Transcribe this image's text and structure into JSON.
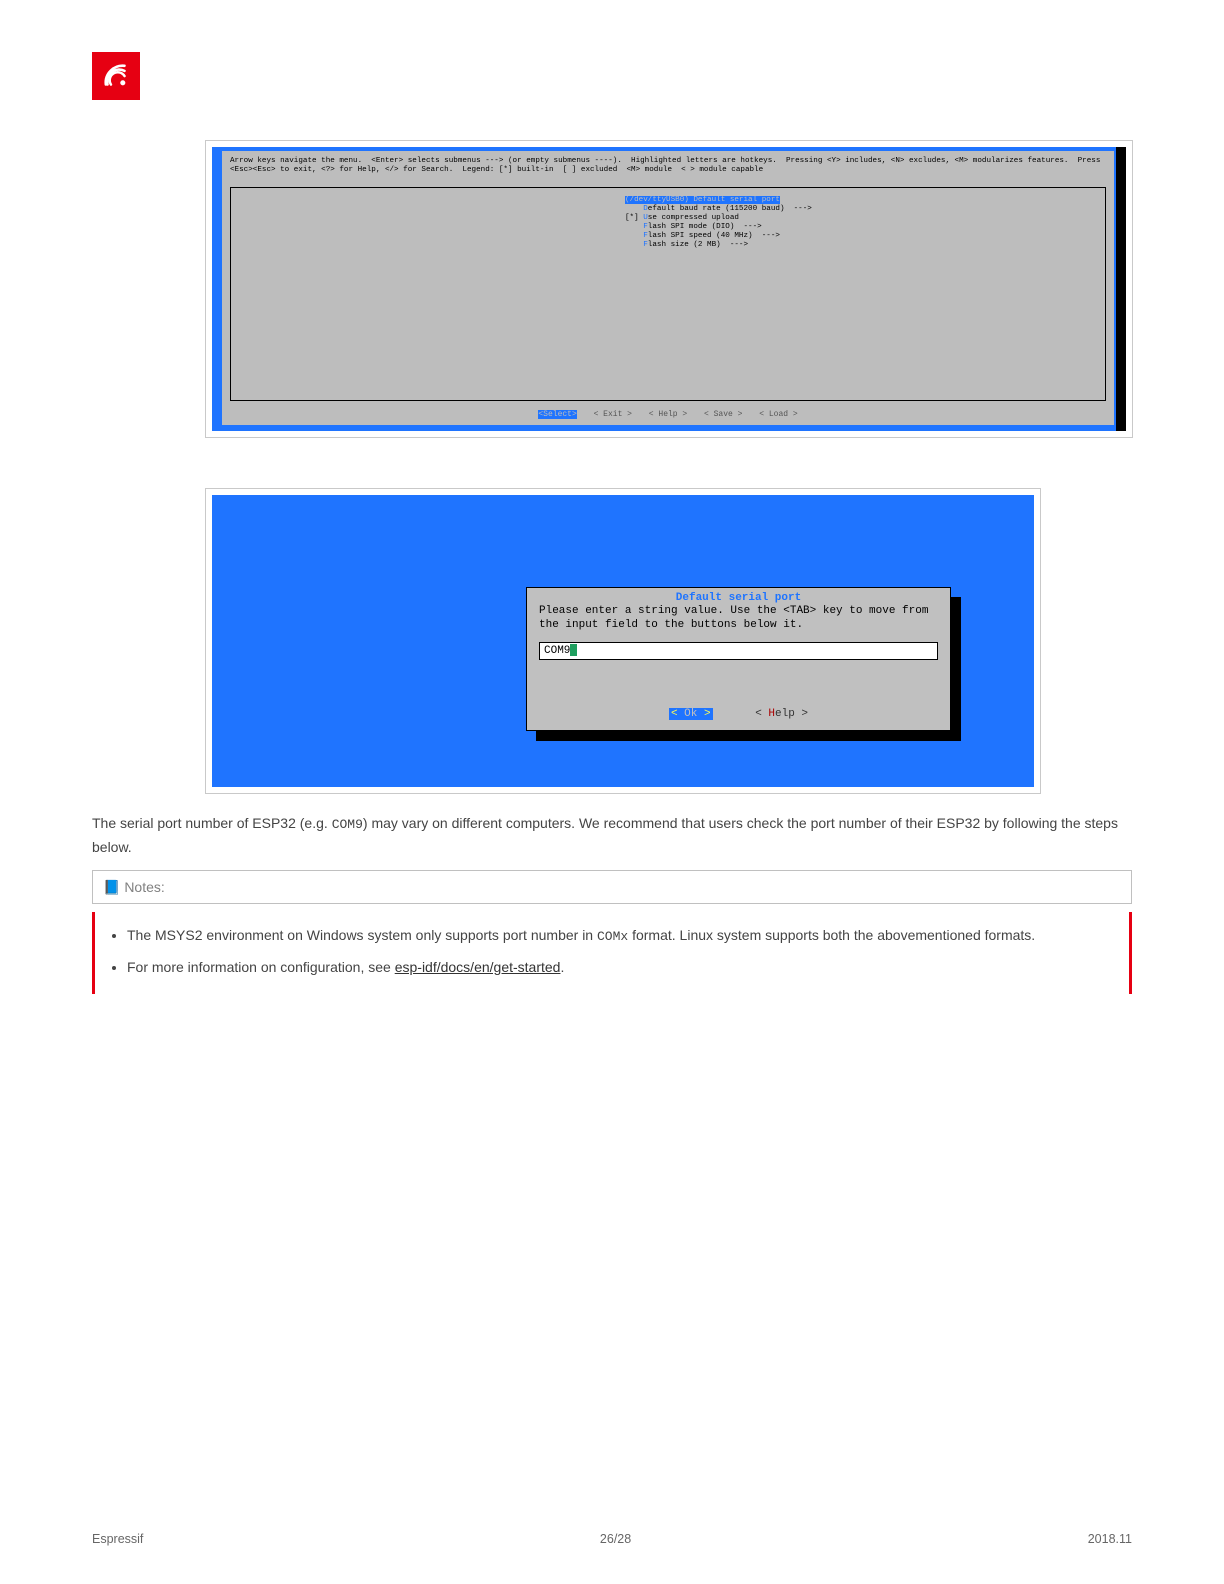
{
  "header": {
    "logo_alt": "Espressif logo"
  },
  "screenshot1": {
    "help_text": "Arrow keys navigate the menu.  <Enter> selects submenus ---> (or empty submenus ----).  Highlighted letters are hotkeys.  Pressing <Y> includes, <N> excludes, <M> modularizes features.  Press <Esc><Esc> to exit, <?> for Help, </> for Search.  Legend: [*] built-in  [ ] excluded  <M> module  < > module capable",
    "items": [
      {
        "prefix": "(",
        "key": "/",
        "rest": "dev/ttyUSB0) Default serial port",
        "selected": true
      },
      {
        "prefix": "    ",
        "key": "D",
        "rest": "efault baud rate (115200 baud)  --->"
      },
      {
        "prefix": "[*] ",
        "key": "U",
        "rest": "se compressed upload"
      },
      {
        "prefix": "    ",
        "key": "F",
        "rest": "lash SPI mode (DIO)  --->"
      },
      {
        "prefix": "    ",
        "key": "F",
        "rest": "lash SPI speed (40 MHz)  --->"
      },
      {
        "prefix": "    ",
        "key": "F",
        "rest": "lash size (2 MB)  --->"
      }
    ],
    "button_select": "<Select>",
    "button_exit": "< Exit >",
    "button_help": "< Help >",
    "button_save": "< Save >",
    "button_load": "< Load >"
  },
  "screenshot2": {
    "title": "Default serial port",
    "message": "Please enter a string value. Use the <TAB> key to move from the input field to the buttons below it.",
    "input_value": "COM9",
    "ok_label_left": "<",
    "ok_label_mid": "  Ok  ",
    "ok_label_right": ">",
    "help_label": "< Help >"
  },
  "body": {
    "para1_prefix": "The serial port number of ESP32 (e.g. ",
    "para1_code": "COM9",
    "para1_suffix": ") may vary on different computers. We recommend that users check the port number of their ESP32 by following the steps below.",
    "notes_title": "📘 Notes:",
    "note1_prefix": "The MSYS2 environment on Windows system only supports port number in ",
    "note1_code": "COMx",
    "note1_suffix": " format. Linux system supports both the abovementioned formats.",
    "note2_prefix": "For more information on configuration, see ",
    "note2_link": "esp-idf/docs/en/get-started",
    "note2_suffix": "."
  },
  "footer": {
    "left": "Espressif",
    "center": "26/28",
    "right": "2018.11"
  }
}
